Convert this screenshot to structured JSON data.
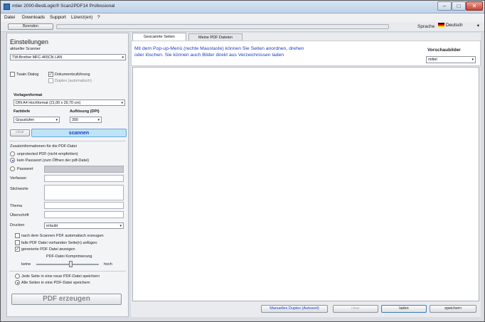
{
  "window": {
    "title": "mtier 2000-BestLogic® Scan2PDF14 Professional"
  },
  "menu": [
    "Datei",
    "Downloads",
    "Support",
    "Lizenz(en)",
    "?"
  ],
  "toolbar": {
    "quit_label": "Beenden",
    "language_label": "Sprache",
    "language_value": "Deutsch"
  },
  "settings": {
    "heading": "Einstellungen",
    "scanner_label": "aktueller Scanner",
    "scanner_value": "TW-Brother MFC-465CN LAN",
    "twain_dialog": {
      "label": "Twain Dialog",
      "checked": false
    },
    "doc_feed": {
      "label": "Dokumentzuführung",
      "checked": true
    },
    "duplex": {
      "label": "Duplex (automatisch)",
      "checked": false
    },
    "template_label": "Vorlagenformat",
    "template_value": "DIN A4 Hochformat (21,00 x 29,70 cm)",
    "color_label": "Farbtiefe",
    "color_value": "Graustufen",
    "resolution_label": "Auflösung (DPI)",
    "resolution_value": "300",
    "clear_label": "clear",
    "scan_label": "scannen",
    "extra_heading": "Zusatzinformationen für die PDF-Datei",
    "radio_unprotected": "unprotected PDF (nicht empfohlen)",
    "radio_nopass": "kein Passwort (zum Öffnen der pdf-Datei)",
    "radio_pass": "Passwort",
    "author_label": "Verfasser",
    "keywords_label": "Stichworte",
    "subject_label": "Thema",
    "title_label": "Überschrift",
    "print_label": "Drucken",
    "print_value": "erlaubt",
    "opt_auto": "nach dem Scannen PDF automatisch erzeugen",
    "opt_append": "falls PDF Datei vorhanden Seite(n) anfügen",
    "opt_show": "generierte PDF Datei anzeigen",
    "compression_label": "PDF-Datei Komprimierung",
    "compression_low": "keine",
    "compression_high": "hoch",
    "compression_level": 0.55,
    "save_each": "Jede Seite in eine neue PDF-Datei speichern",
    "save_all": "Alle Seiten in eine PDF-Datei speichern",
    "create_pdf": "PDF erzeugen"
  },
  "tabs": [
    "Gescannte Seiten",
    "Meine PDF Dateien"
  ],
  "info": {
    "text": "Mit dem  Pop-up-Menü (rechte Maustaste) können Sie Seiten anordnen, drehen oder löschen. Sie können auch Bilder direkt aus Verzeichnissen laden",
    "preview_label": "Vorschaubilder",
    "preview_value": "mittel"
  },
  "bottom": {
    "duplex_btn": "Manuelles Duplex (Autosort)",
    "clear_btn": "clear",
    "load_btn": "laden",
    "save_btn": "speichern"
  },
  "colors": {
    "accent": "#1a3cc7",
    "scan_button": "#bfe3f7"
  }
}
